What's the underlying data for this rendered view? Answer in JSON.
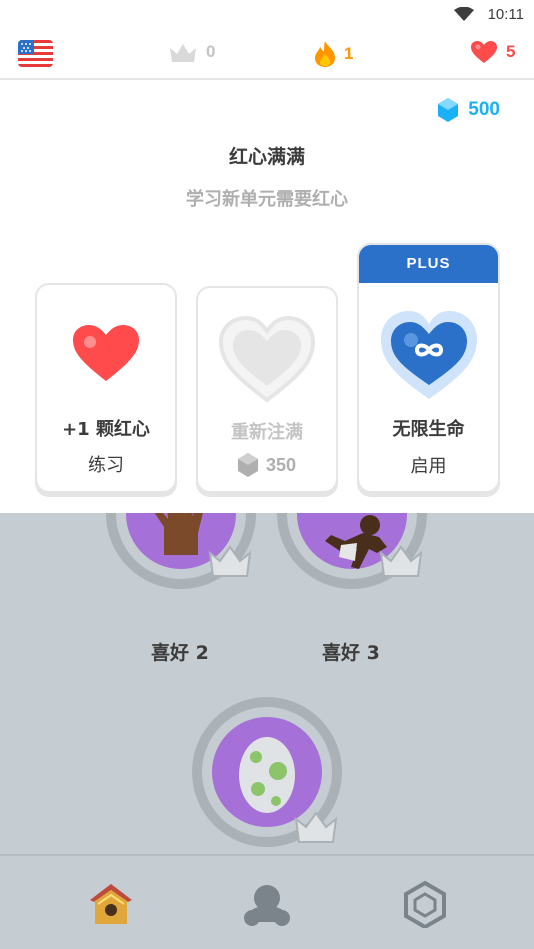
{
  "status_bar": {
    "time": "10:11"
  },
  "top_bar": {
    "language": "us-flag-icon",
    "crowns": "0",
    "streak": "1",
    "hearts": "5"
  },
  "panel": {
    "gems": "500",
    "title": "红心满满",
    "subtitle": "学习新单元需要红心",
    "cards": {
      "practice": {
        "title": "+1 颗红心",
        "subtitle": "练习"
      },
      "refill": {
        "title": "重新注满",
        "cost": "350"
      },
      "plus": {
        "banner": "PLUS",
        "title": "无限生命",
        "subtitle": "启用"
      }
    }
  },
  "skills": [
    {
      "label": "喜好 2",
      "icon": "hand-icon"
    },
    {
      "label": "喜好 3",
      "icon": "running-person-icon"
    },
    {
      "label": "",
      "icon": "egg-icon"
    }
  ],
  "colors": {
    "heart": "#ff4b4b",
    "gem": "#1cb0f6",
    "plus": "#2b70c9",
    "skill": "#a570d8",
    "overlay": "#c5cdd2"
  },
  "bottom_nav": [
    "home-icon",
    "profile-icon",
    "shop-icon"
  ]
}
